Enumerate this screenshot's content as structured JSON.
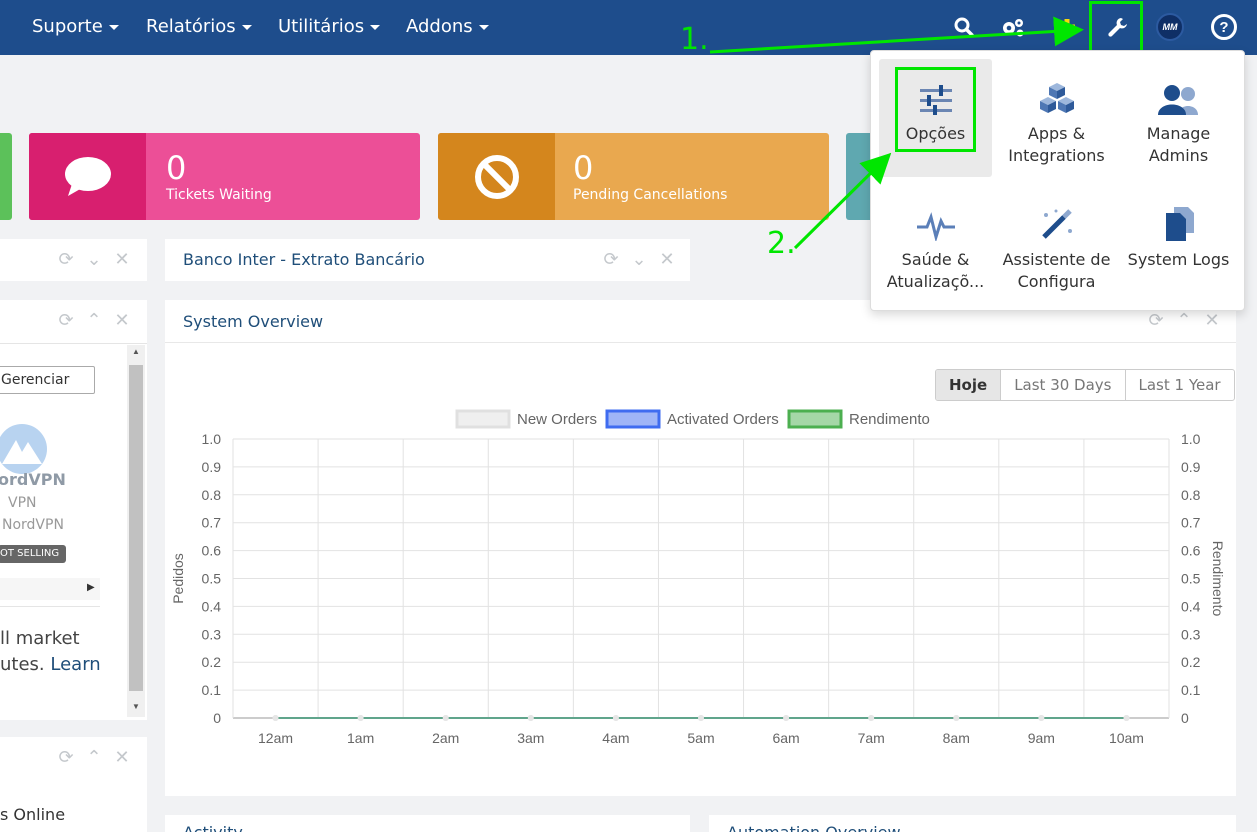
{
  "nav": {
    "items": [
      {
        "label": "Suporte"
      },
      {
        "label": "Relatórios"
      },
      {
        "label": "Utilitários"
      },
      {
        "label": "Addons"
      }
    ],
    "avatar_initials": "MM"
  },
  "stats": [
    {
      "value": "0",
      "label": "Tickets Waiting",
      "color": "#ec4f97",
      "icon_color": "#d81f6f",
      "icon": "chat-bubble-icon"
    },
    {
      "value": "0",
      "label": "Pending Cancellations",
      "color": "#e9a84f",
      "icon_color": "#d4861d",
      "icon": "ban-icon"
    }
  ],
  "panels": {
    "banco": {
      "title": "Banco Inter - Extrato Bancário"
    },
    "system": {
      "title": "System Overview"
    },
    "activity": {
      "title": "Activity"
    },
    "automation": {
      "title": "Automation Overview"
    }
  },
  "left_panel": {
    "button": "Gerenciar",
    "vpn_brand": "ordVPN",
    "vpn_line1": "VPN",
    "vpn_line2": "NordVPN",
    "badge": "OT SELLING",
    "text_line1": "ll market",
    "text_line2": "utes.",
    "text_link": "Learn",
    "online": "s Online"
  },
  "chart_controls": [
    "Hoje",
    "Last 30 Days",
    "Last 1 Year"
  ],
  "chart_data": {
    "type": "line",
    "categories": [
      "12am",
      "1am",
      "2am",
      "3am",
      "4am",
      "5am",
      "6am",
      "7am",
      "8am",
      "9am",
      "10am"
    ],
    "series": [
      {
        "name": "New Orders",
        "values": [
          0,
          0,
          0,
          0,
          0,
          0,
          0,
          0,
          0,
          0,
          0
        ],
        "color": "#e0e0e0"
      },
      {
        "name": "Activated Orders",
        "values": [
          0,
          0,
          0,
          0,
          0,
          0,
          0,
          0,
          0,
          0,
          0
        ],
        "color": "#3f6cf0"
      },
      {
        "name": "Rendimento",
        "values": [
          0,
          0,
          0,
          0,
          0,
          0,
          0,
          0,
          0,
          0,
          0
        ],
        "color": "#4caf50"
      }
    ],
    "ylabel": "Pedidos",
    "y2label": "Rendimento",
    "ylim": [
      0,
      1.0
    ],
    "yticks": [
      "1.0",
      "0.9",
      "0.8",
      "0.7",
      "0.6",
      "0.5",
      "0.4",
      "0.3",
      "0.2",
      "0.1",
      "0"
    ],
    "grid": true,
    "legend": "top"
  },
  "dropdown": {
    "items": [
      {
        "label": "Opções",
        "icon": "sliders-icon"
      },
      {
        "label": "Apps & Integrations",
        "icon": "cubes-icon"
      },
      {
        "label": "Manage Admins",
        "icon": "users-icon"
      },
      {
        "label": "Saúde & Atualizaçõ...",
        "icon": "heartbeat-icon"
      },
      {
        "label": "Assistente de Configura",
        "icon": "magic-wand-icon"
      },
      {
        "label": "System Logs",
        "icon": "files-icon"
      }
    ]
  },
  "annotations": {
    "step1": "1.",
    "step2": "2.",
    "color": "#00e600"
  }
}
